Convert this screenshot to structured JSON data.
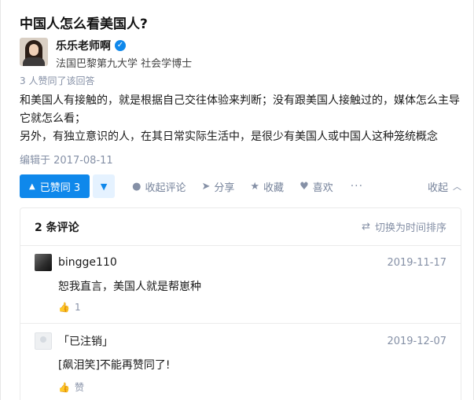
{
  "question": {
    "title": "中国人怎么看美国人?"
  },
  "author": {
    "name": "乐乐老师啊",
    "headline": "法国巴黎第九大学 社会学博士",
    "verified_icon": "verified-badge-icon"
  },
  "answer": {
    "vote_summary": "3 人赞同了该回答",
    "paragraphs": [
      "和美国人有接触的，就是根据自己交往体验来判断；没有跟美国人接触过的，媒体怎么主导它就怎么看；",
      "另外，有独立意识的人，在其日常实际生活中，是很少有美国人或中国人这种笼统概念"
    ],
    "edit_time": "编辑于 2017-08-11"
  },
  "actions": {
    "upvote_label": "已赞同 3",
    "comment_label": "收起评论",
    "share_label": "分享",
    "collect_label": "收藏",
    "like_label": "喜欢",
    "more_label": "···",
    "collapse_label": "收起"
  },
  "comments": {
    "count_label": "2 条评论",
    "sort_label": "切换为时间排序",
    "items": [
      {
        "name": "bingge110",
        "date": "2019-11-17",
        "text": "恕我直言，美国人就是帮崽种",
        "like_label": "1"
      },
      {
        "name": "「已注销」",
        "date": "2019-12-07",
        "text": "[飙泪笑]不能再赞同了!",
        "like_label": "赞"
      }
    ]
  }
}
